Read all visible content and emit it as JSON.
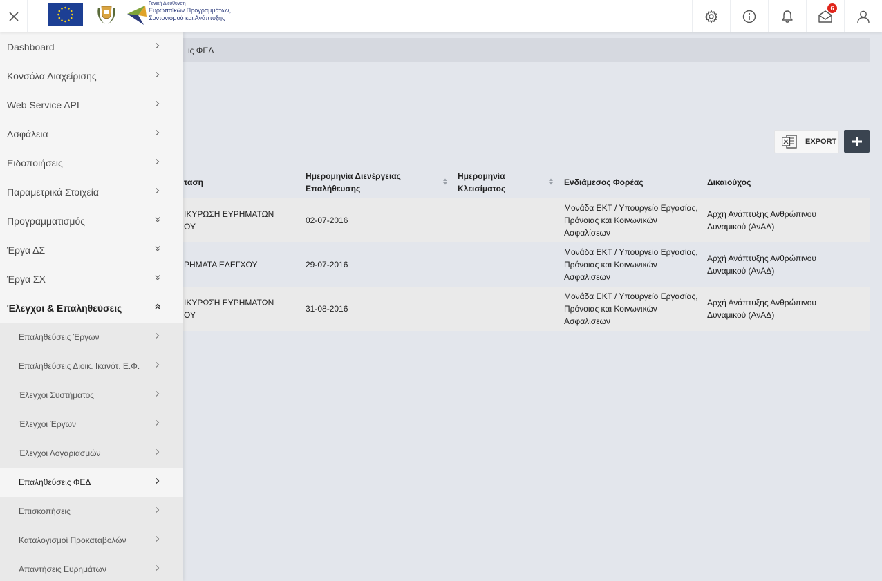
{
  "header": {
    "logo_text_small": "Γενική Διεύθυνση",
    "logo_text_line1": "Ευρωπαϊκών Προγραμμάτων,",
    "logo_text_line2": "Συντονισμού και Ανάπτυξης",
    "notification_count": "6"
  },
  "breadcrumb": {
    "current": "ις ΦΕΔ"
  },
  "toolbar": {
    "export_label": "EXPORT"
  },
  "table": {
    "headers": {
      "status": "ταση",
      "date_conducted_line1": "Ημερομηνία Διενέργειας",
      "date_conducted_line2": "Επαλήθευσης",
      "close_date_line1": "Ημερομηνία",
      "close_date_line2": "Κλεισίματος",
      "intermediate_body": "Ενδιάμεσος Φορέας",
      "beneficiary": "Δικαιούχος"
    },
    "rows": [
      {
        "status_line1": "ΙΚΥΡΩΣΗ ΕΥΡΗΜΑΤΩΝ",
        "status_line2": "ΟΥ",
        "date": "02-07-2016",
        "body_line1": "Μονάδα ΕΚΤ / Υπουργείο Εργασίας,",
        "body_line2": "Πρόνοιας και Κοινωνικών",
        "body_line3": "Ασφαλίσεων",
        "beneficiary_line1": "Αρχή Ανάπτυξης Ανθρώπινου",
        "beneficiary_line2": "Δυναμικού (ΑνΑΔ)"
      },
      {
        "status_line1": "ΡΗΜΑΤΑ ΕΛΕΓΧΟΥ",
        "status_line2": "",
        "date": "29-07-2016",
        "body_line1": "Μονάδα ΕΚΤ / Υπουργείο Εργασίας,",
        "body_line2": "Πρόνοιας και Κοινωνικών",
        "body_line3": "Ασφαλίσεων",
        "beneficiary_line1": "Αρχή Ανάπτυξης Ανθρώπινου",
        "beneficiary_line2": "Δυναμικού (ΑνΑΔ)"
      },
      {
        "status_line1": "ΙΚΥΡΩΣΗ ΕΥΡΗΜΑΤΩΝ",
        "status_line2": "ΟΥ",
        "date": "31-08-2016",
        "body_line1": "Μονάδα ΕΚΤ / Υπουργείο Εργασίας,",
        "body_line2": "Πρόνοιας και Κοινωνικών",
        "body_line3": "Ασφαλίσεων",
        "beneficiary_line1": "Αρχή Ανάπτυξης Ανθρώπινου",
        "beneficiary_line2": "Δυναμικού (ΑνΑΔ)"
      }
    ]
  },
  "sidebar": {
    "items": [
      {
        "label": "Dashboard"
      },
      {
        "label": "Κονσόλα Διαχείρισης"
      },
      {
        "label": "Web Service API"
      },
      {
        "label": "Ασφάλεια"
      },
      {
        "label": "Ειδοποιήσεις"
      },
      {
        "label": "Παραμετρικά Στοιχεία"
      },
      {
        "label": "Προγραμματισμός"
      },
      {
        "label": "Έργα ΔΣ"
      },
      {
        "label": "Έργα ΣΧ"
      },
      {
        "label": "Έλεγχοι & Επαληθεύσεις"
      }
    ],
    "subitems": [
      {
        "label": "Επαληθεύσεις Έργων"
      },
      {
        "label": "Επαληθεύσεις Διοικ. Ικανότ. Ε.Φ."
      },
      {
        "label": "Έλεγχοι Συστήματος"
      },
      {
        "label": "Έλεγχοι Έργων"
      },
      {
        "label": "Έλεγχοι Λογαριασμών"
      },
      {
        "label": "Επαληθεύσεις ΦΕΔ"
      },
      {
        "label": "Επισκοπήσεις"
      },
      {
        "label": "Καταλογισμοί Προκαταβολών"
      },
      {
        "label": "Απαντήσεις Ευρημάτων"
      }
    ]
  },
  "colors": {
    "accent_dark": "#3a4450",
    "badge": "#e0251b",
    "eu_blue": "#1d3f94"
  }
}
